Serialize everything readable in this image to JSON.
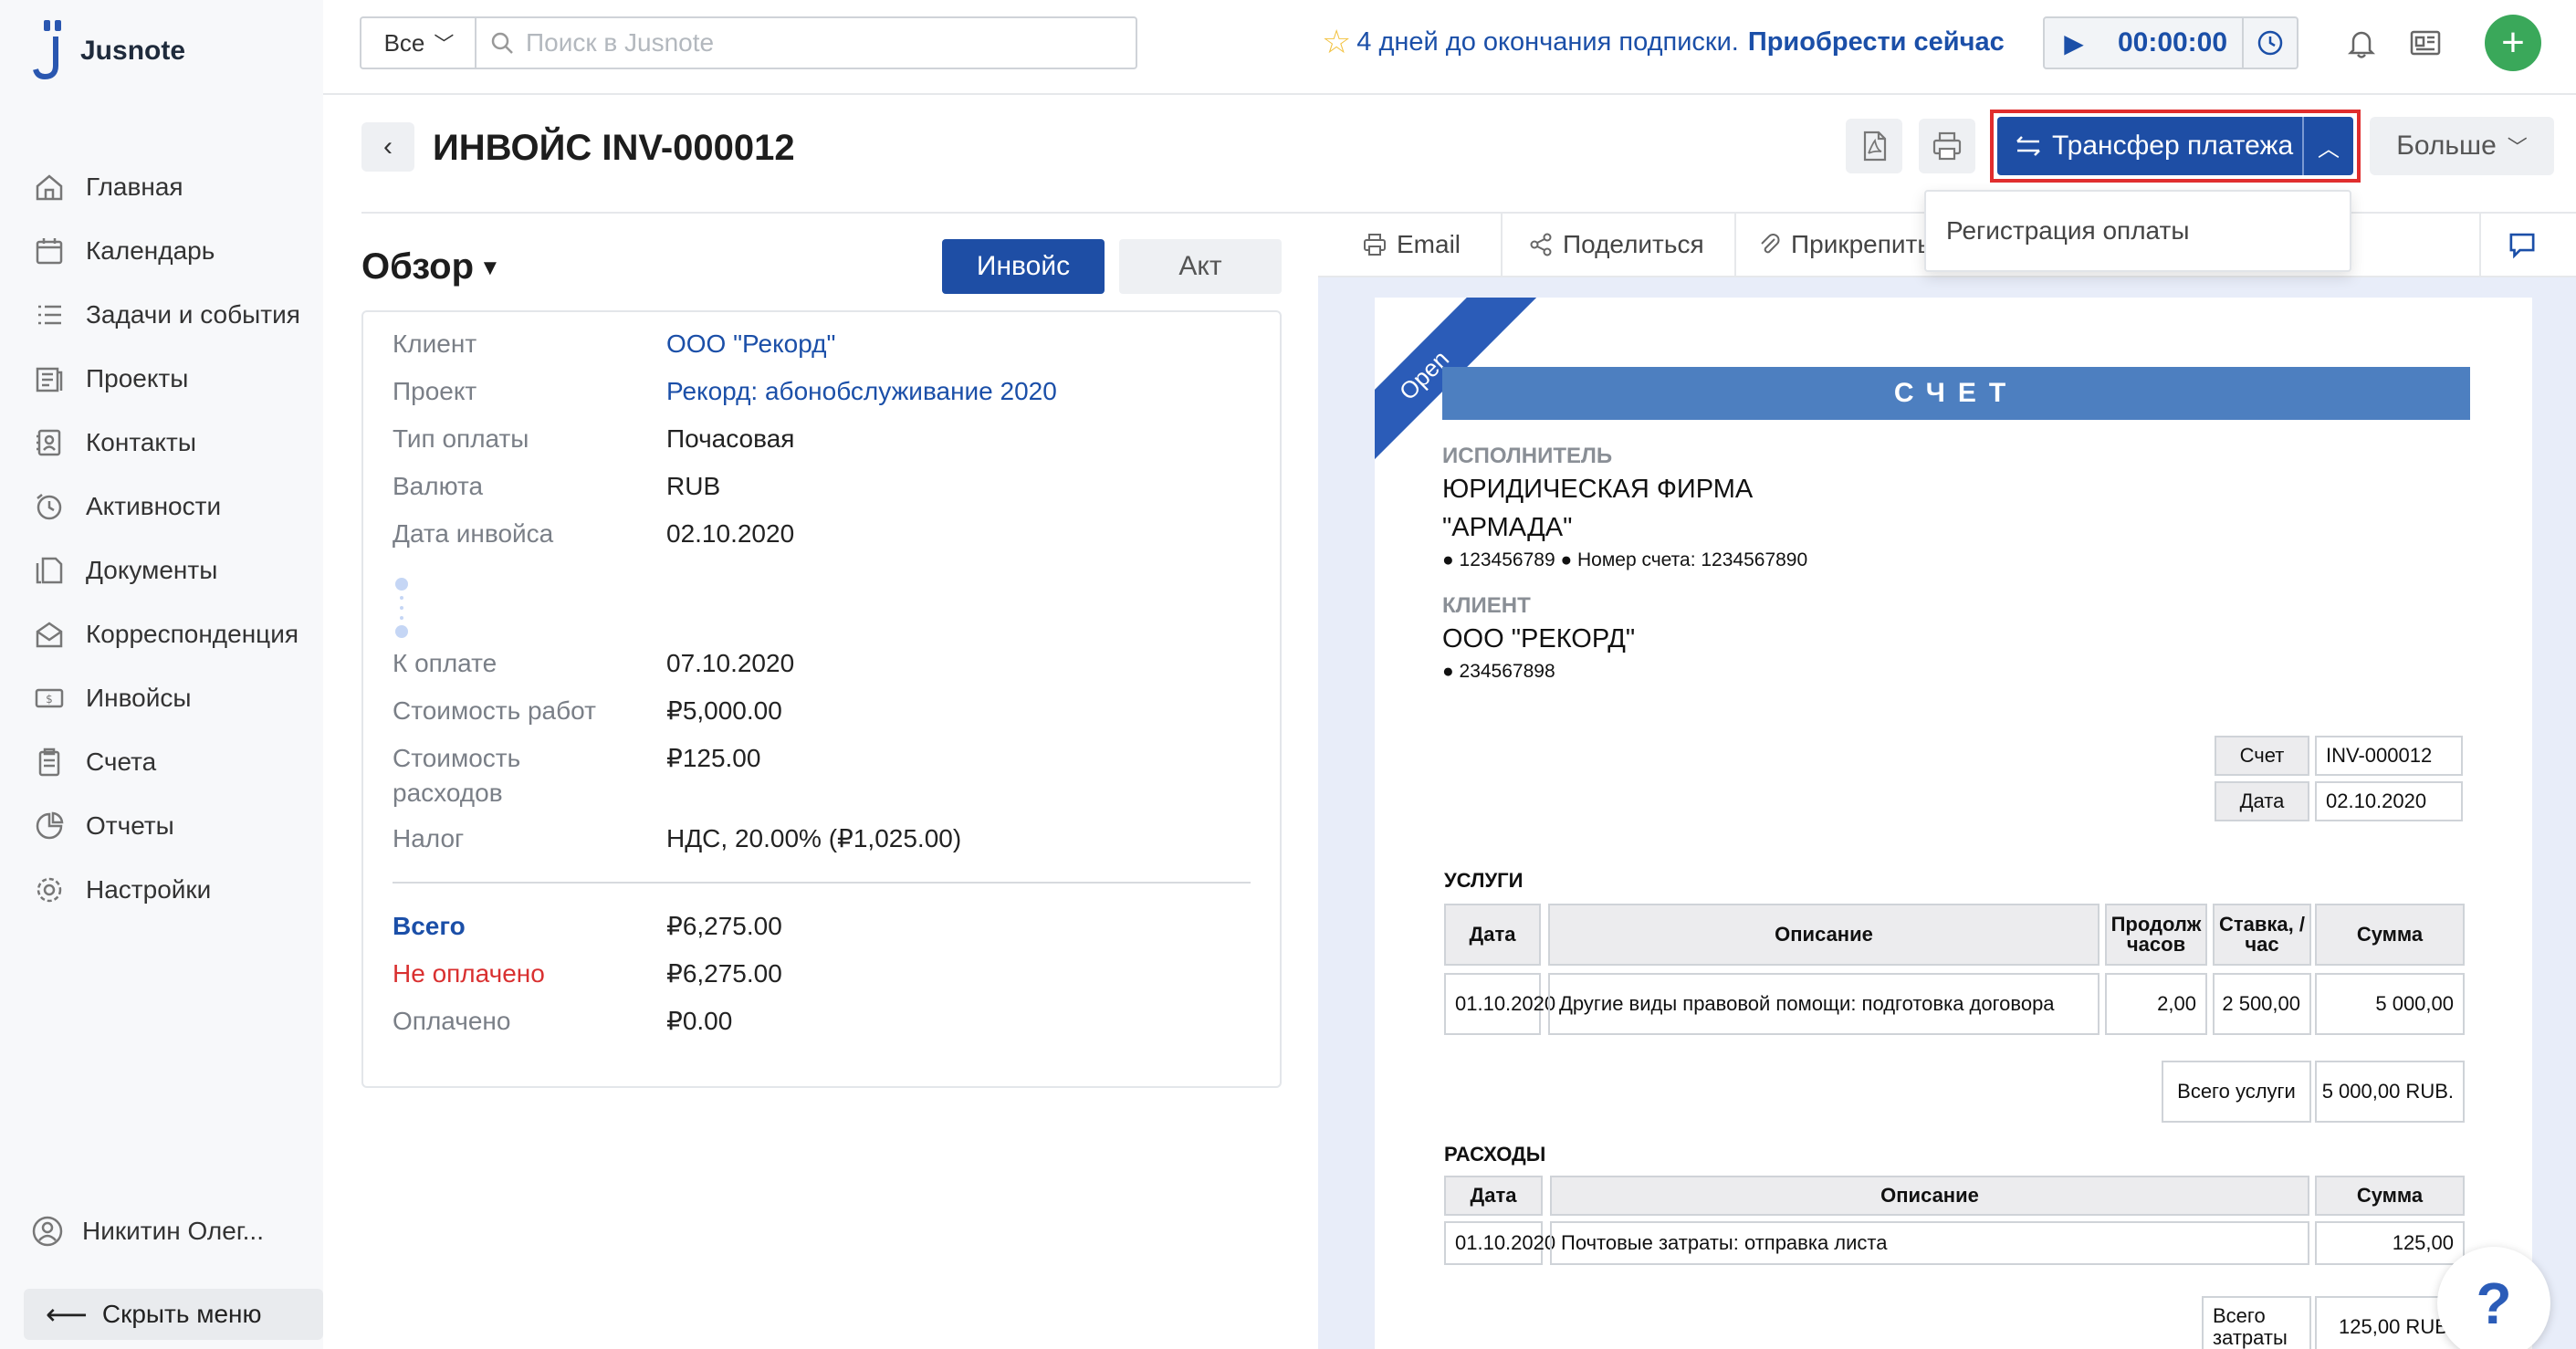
{
  "app": {
    "name": "Jusnote"
  },
  "sidebar": {
    "items": [
      {
        "label": "Главная",
        "icon": "home-icon"
      },
      {
        "label": "Календарь",
        "icon": "calendar-icon"
      },
      {
        "label": "Задачи и события",
        "icon": "tasks-icon"
      },
      {
        "label": "Проекты",
        "icon": "projects-icon"
      },
      {
        "label": "Контакты",
        "icon": "contacts-icon"
      },
      {
        "label": "Активности",
        "icon": "activity-icon"
      },
      {
        "label": "Документы",
        "icon": "documents-icon"
      },
      {
        "label": "Корреспонденция",
        "icon": "mail-icon"
      },
      {
        "label": "Инвойсы",
        "icon": "invoice-icon"
      },
      {
        "label": "Счета",
        "icon": "bills-icon"
      },
      {
        "label": "Отчеты",
        "icon": "reports-icon"
      },
      {
        "label": "Настройки",
        "icon": "settings-icon"
      }
    ],
    "user": "Никитин Олег...",
    "hide_menu": "Скрыть меню"
  },
  "topbar": {
    "scope": "Все",
    "search_placeholder": "Поиск в Jusnote",
    "promo_days": "4 дней до окончания подписки.",
    "promo_buy": "Приобрести сейчас",
    "timer": "00:00:00"
  },
  "header": {
    "title": "ИНВОЙС INV-000012",
    "transfer_button": "Трансфер платежа",
    "more_button": "Больше",
    "dropdown_item": "Регистрация оплаты"
  },
  "overview": {
    "title": "Обзор",
    "segments": {
      "invoice": "Инвойс",
      "act": "Акт"
    },
    "rows": [
      {
        "label": "Клиент",
        "value": "ООО \"Рекорд\""
      },
      {
        "label": "Проект",
        "value": "Рекорд: абонобслуживание 2020"
      },
      {
        "label": "Тип оплаты",
        "value": "Почасовая"
      },
      {
        "label": "Валюта",
        "value": "RUB"
      },
      {
        "label": "Дата инвойса",
        "value": "02.10.2020"
      },
      {
        "label": "К оплате",
        "value": "07.10.2020"
      },
      {
        "label": "Стоимость работ",
        "value": "₽5,000.00"
      },
      {
        "label": "Стоимость расходов",
        "value": "₽125.00"
      },
      {
        "label": "Налог",
        "value": "НДС, 20.00% (₽1,025.00)"
      }
    ],
    "totals": [
      {
        "label": "Всего",
        "value": "₽6,275.00"
      },
      {
        "label": "Не оплачено",
        "value": "₽6,275.00"
      },
      {
        "label": "Оплачено",
        "value": "₽0.00"
      }
    ]
  },
  "preview": {
    "tabs": {
      "email": "Email",
      "share": "Поделиться",
      "attach": "Прикрепить"
    },
    "ribbon": "Open",
    "doc_title": "СЧЕТ",
    "executor_label": "ИСПОЛНИТЕЛЬ",
    "executor_line1": "ЮРИДИЧЕСКАЯ ФИРМА",
    "executor_line2": "\"АРМАДА\"",
    "executor_meta": "● 123456789 ● Номер счета: 1234567890",
    "client_label": "КЛИЕНТ",
    "client_name": "ООО \"РЕКОРД\"",
    "client_meta": "● 234567898",
    "meta": {
      "invoice_label": "Счет",
      "invoice_value": "INV-000012",
      "date_label": "Дата",
      "date_value": "02.10.2020"
    },
    "services": {
      "title": "УСЛУГИ",
      "headers": [
        "Дата",
        "Описание",
        "Продолж часов",
        "Ставка, /час",
        "Сумма"
      ],
      "row": [
        "01.10.2020",
        "Другие виды правовой помощи: подготовка договора",
        "2,00",
        "2 500,00",
        "5 000,00"
      ],
      "total_label": "Всего услуги",
      "total_value": "5 000,00 RUB."
    },
    "expenses": {
      "title": "РАСХОДЫ",
      "headers": [
        "Дата",
        "Описание",
        "Сумма"
      ],
      "row": [
        "01.10.2020",
        "Почтовые затраты: отправка листа",
        "125,00"
      ],
      "total_label": "Всего затраты",
      "total_value": "125,00 RUB."
    }
  },
  "colors": {
    "primary": "#1e4ea5",
    "highlight": "#e02d2d",
    "add": "#3aa85a",
    "danger": "#d93030"
  }
}
